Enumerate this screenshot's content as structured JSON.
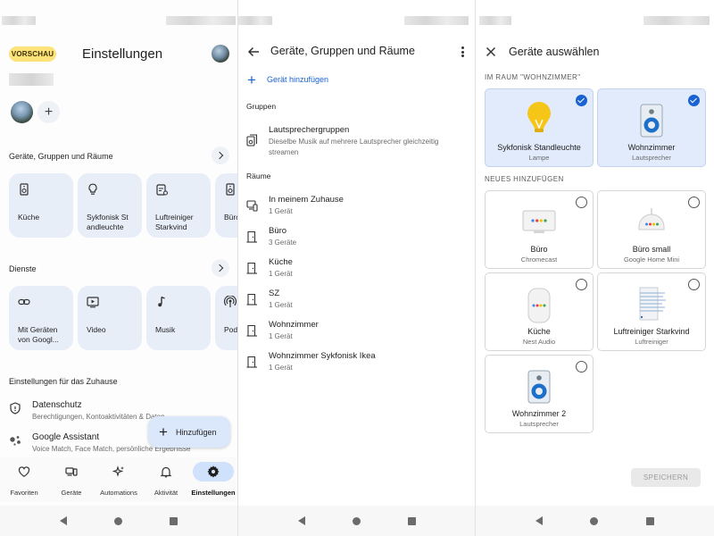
{
  "screen1": {
    "preview_chip": "VORSCHAU",
    "title": "Einstellungen",
    "devices_section": {
      "heading": "Geräte, Gruppen und Räume",
      "tiles": [
        {
          "label": "Küche",
          "icon": "speaker-icon"
        },
        {
          "label": "Sykfonisk St andleuchte",
          "icon": "lightbulb-icon"
        },
        {
          "label": "Luftreiniger Starkvind",
          "icon": "air-purifier-icon"
        },
        {
          "label": "Büro",
          "icon": "speaker-icon"
        }
      ]
    },
    "services_section": {
      "heading": "Dienste",
      "tiles": [
        {
          "label": "Mit Geräten von Googl...",
          "icon": "link-icon"
        },
        {
          "label": "Video",
          "icon": "video-icon"
        },
        {
          "label": "Musik",
          "icon": "music-note-icon"
        },
        {
          "label": "Pod",
          "icon": "podcast-icon"
        }
      ]
    },
    "home_settings": {
      "heading": "Einstellungen für das Zuhause",
      "rows": [
        {
          "title": "Datenschutz",
          "subtitle": "Berechtigungen, Kontoaktivitäten & Daten",
          "icon": "shield-icon"
        },
        {
          "title": "Google Assistant",
          "subtitle": "Voice Match, Face Match, persönliche Ergebnisse",
          "icon": "assistant-icon"
        }
      ]
    },
    "fab_label": "Hinzufügen",
    "bottom_nav": [
      {
        "label": "Favoriten",
        "icon": "heart-icon"
      },
      {
        "label": "Geräte",
        "icon": "devices-icon"
      },
      {
        "label": "Automations",
        "icon": "sparkle-icon"
      },
      {
        "label": "Aktivität",
        "icon": "bell-icon"
      },
      {
        "label": "Einstellungen",
        "icon": "gear-icon"
      }
    ],
    "active_nav": "Einstellungen"
  },
  "screen2": {
    "title": "Geräte, Gruppen und Räume",
    "add_device": "Gerät hinzufügen",
    "groups_heading": "Gruppen",
    "groups": [
      {
        "title": "Lautsprechergruppen",
        "subtitle": "Dieselbe Musik auf mehrere Lautsprecher gleichzeitig streamen"
      }
    ],
    "rooms_heading": "Räume",
    "rooms": [
      {
        "title": "In meinem Zuhause",
        "subtitle": "1 Gerät"
      },
      {
        "title": "Büro",
        "subtitle": "3 Geräte"
      },
      {
        "title": "Küche",
        "subtitle": "1 Gerät"
      },
      {
        "title": "SZ",
        "subtitle": "1 Gerät"
      },
      {
        "title": "Wohnzimmer",
        "subtitle": "1 Gerät"
      },
      {
        "title": "Wohnzimmer Sykfonisk Ikea",
        "subtitle": "1 Gerät"
      }
    ]
  },
  "screen3": {
    "title": "Geräte auswählen",
    "in_room_caption": "IM RAUM \"WOHNZIMMER\"",
    "in_room": [
      {
        "name": "Sykfonisk Standleuchte",
        "type": "Lampe",
        "selected": true
      },
      {
        "name": "Wohnzimmer",
        "type": "Lautsprecher",
        "selected": true
      }
    ],
    "add_new_caption": "NEUES HINZUFÜGEN",
    "add_new": [
      {
        "name": "Büro",
        "type": "Chromecast",
        "selected": false
      },
      {
        "name": "Büro small",
        "type": "Google Home Mini",
        "selected": false
      },
      {
        "name": "Küche",
        "type": "Nest Audio",
        "selected": false
      },
      {
        "name": "Luftreiniger Starkvind",
        "type": "Luftreiniger",
        "selected": false
      },
      {
        "name": "Wohnzimmer 2",
        "type": "Lautsprecher",
        "selected": false
      }
    ],
    "save_label": "SPEICHERN"
  },
  "colors": {
    "accent": "#1a62d2",
    "tile_bg": "#e8eef8",
    "selected_card_bg": "#e1ebfb",
    "preview_chip": "#fde37a",
    "lamp_yellow": "#f5c518"
  }
}
